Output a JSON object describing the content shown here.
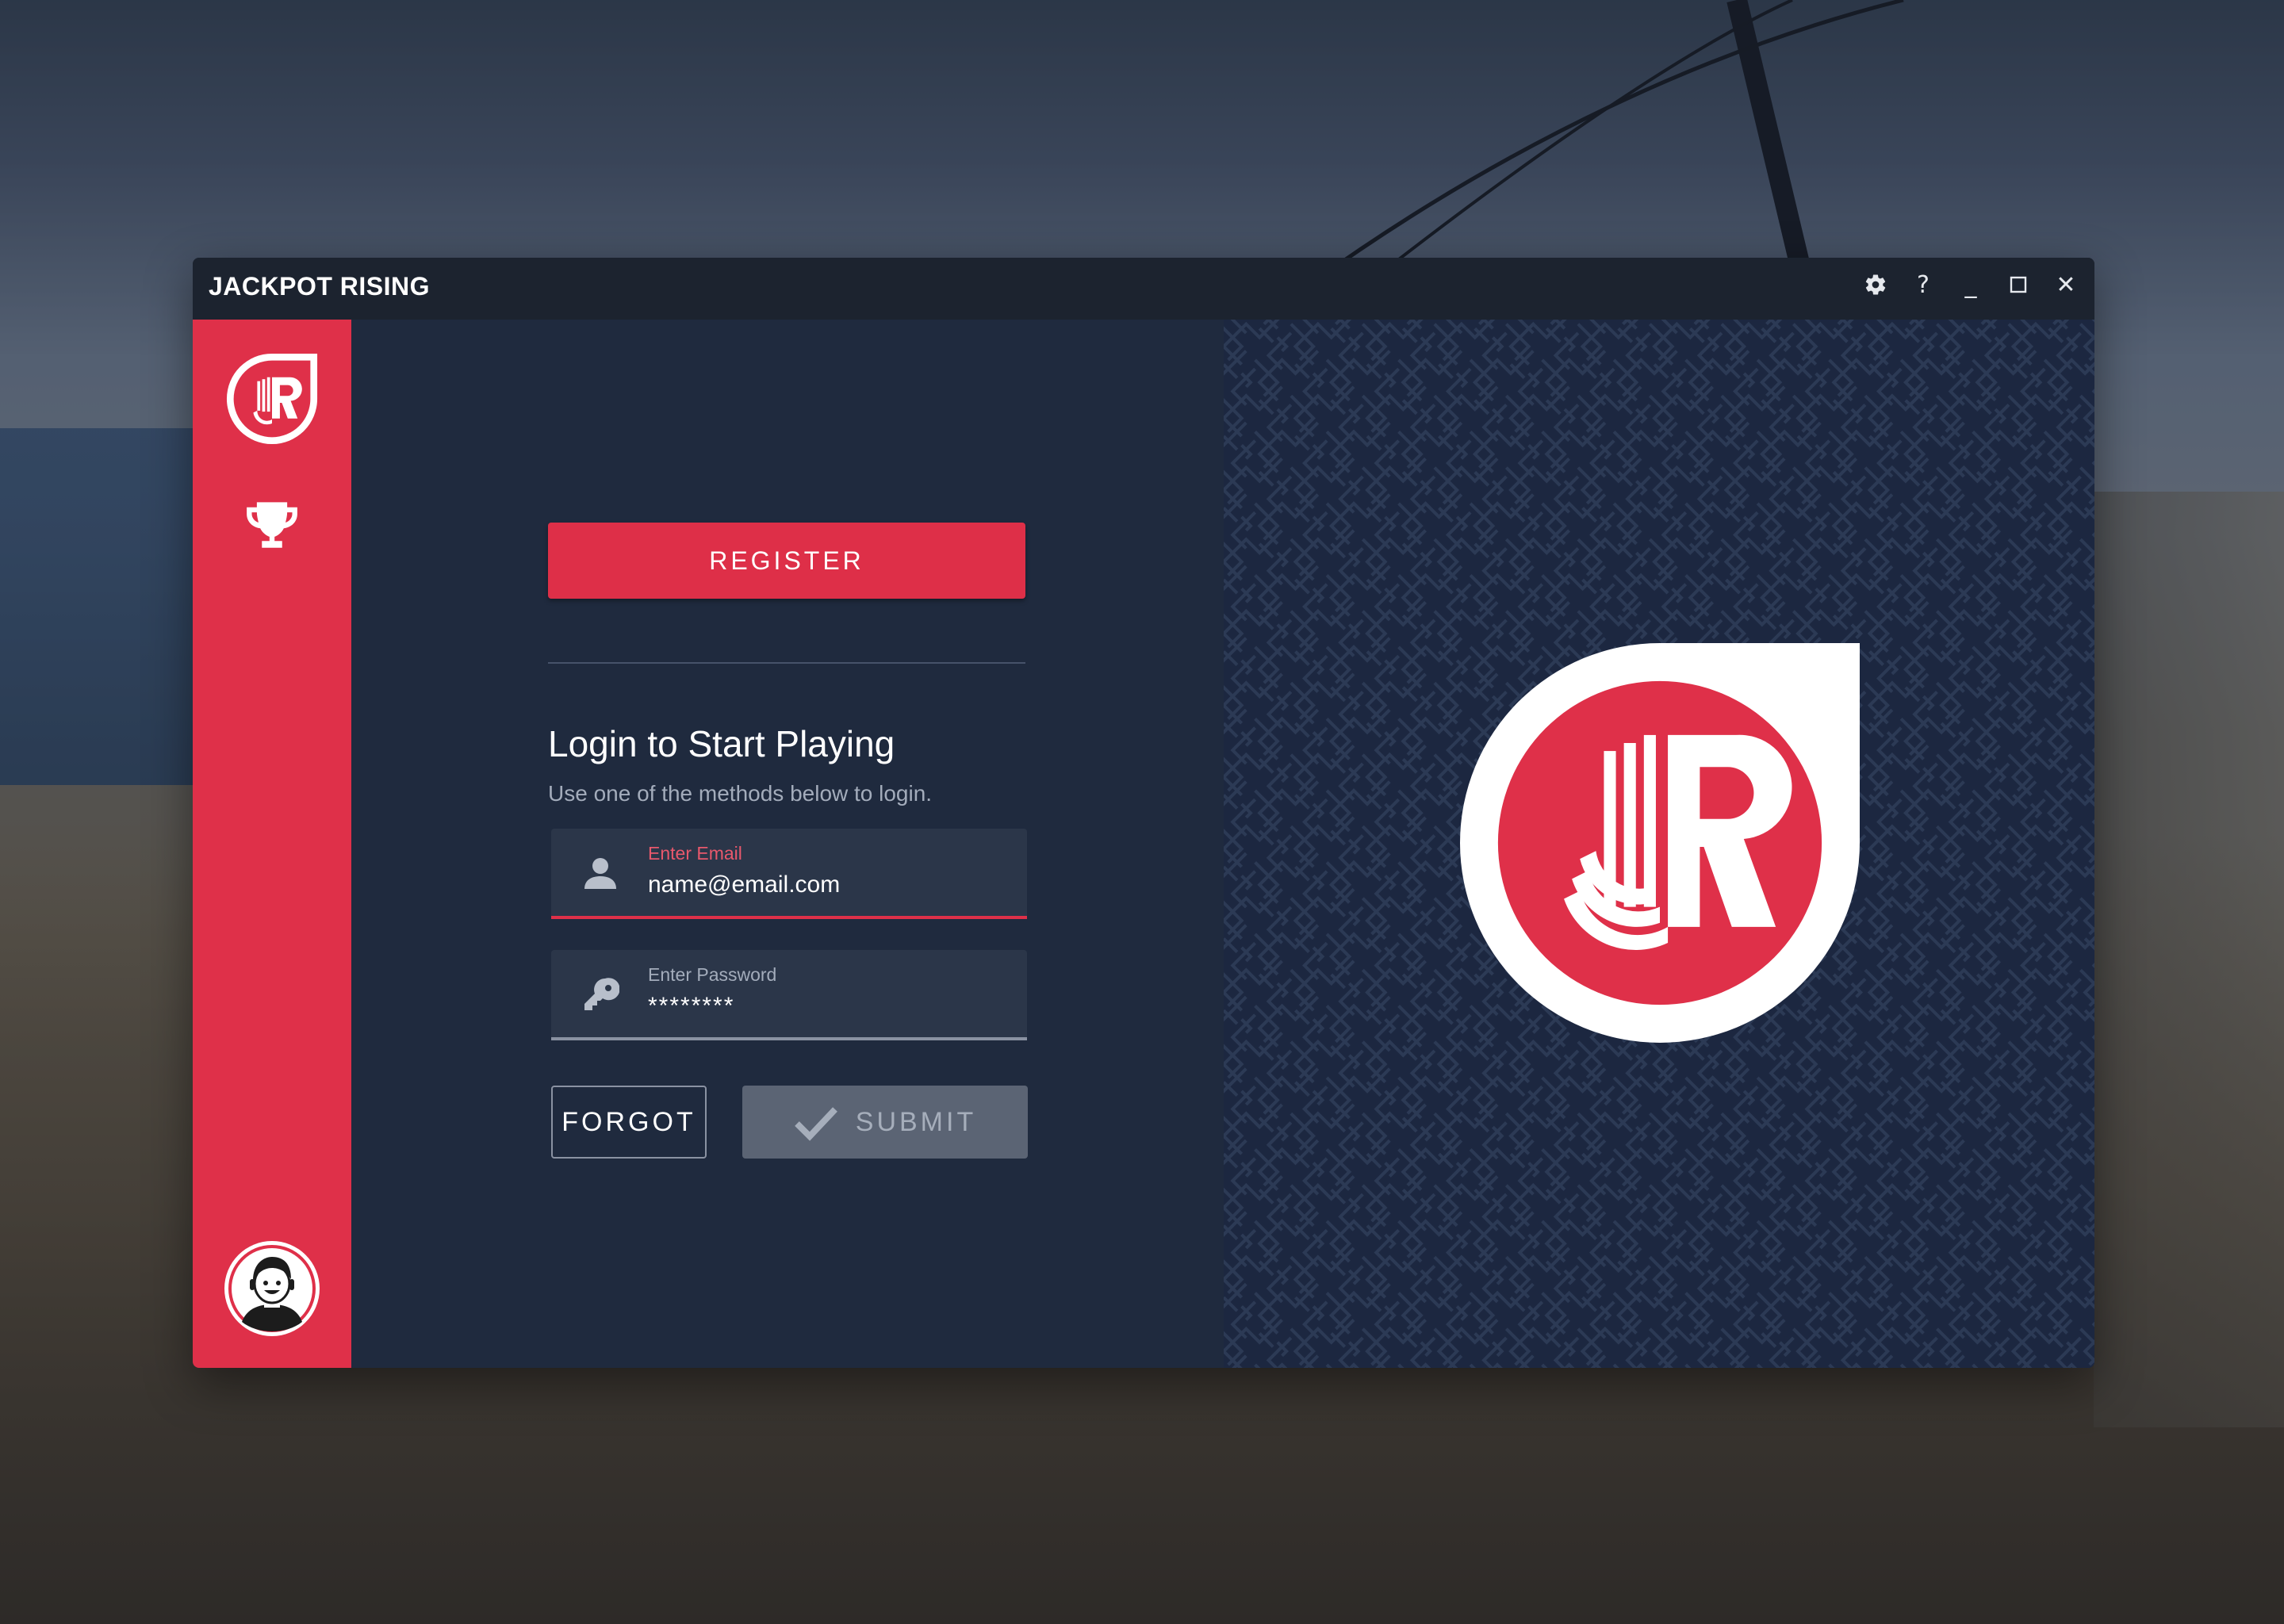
{
  "window": {
    "title": "JACKPOT RISING",
    "controls": {
      "settings_icon": "gear-icon",
      "help_label": "?",
      "minimize_label": "_",
      "maximize_icon": "square-icon",
      "close_label": "✕"
    }
  },
  "sidebar": {
    "logo_icon": "jr-logo-icon",
    "items": [
      {
        "icon": "trophy-icon"
      }
    ],
    "avatar_icon": "avatar-icon"
  },
  "login": {
    "register_label": "REGISTER",
    "heading": "Login to Start Playing",
    "subheading": "Use one of the methods below to login.",
    "email": {
      "label": "Enter Email",
      "value": "name@email.com",
      "icon": "user-icon"
    },
    "password": {
      "label": "Enter Password",
      "value": "********",
      "icon": "key-icon"
    },
    "forgot_label": "FORGOT",
    "submit_label": "SUBMIT",
    "submit_icon": "check-icon"
  },
  "brand": {
    "logo_icon": "jr-logo-icon",
    "colors": {
      "accent": "#df3049",
      "panel": "#1f2a3e",
      "pattern_bg": "#1c2740",
      "titlebar": "#1c232f",
      "submit_disabled": "#5b6474"
    }
  }
}
